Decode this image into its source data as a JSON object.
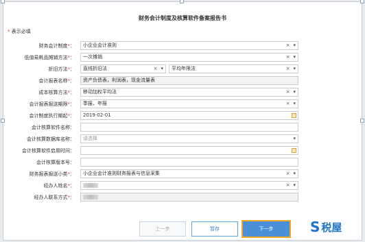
{
  "dialog": {
    "title": "财务会计制度及核算软件备案报告书",
    "required_note": "表示必填"
  },
  "fields": [
    {
      "label": "财务会计制度",
      "required": true,
      "value": "小企业会计准则",
      "kind": "select"
    },
    {
      "label": "低值易耗品摊销方法",
      "required": true,
      "value": "一次摊销",
      "kind": "select"
    },
    {
      "label": "折旧方法",
      "required": true,
      "value": "直线折旧法",
      "value2": "平均年限法",
      "kind": "select2"
    },
    {
      "label": "会计报表名称",
      "required": true,
      "value": "资产负债表，利润表，现金流量表",
      "kind": "readonly"
    },
    {
      "label": "成本核算方法",
      "required": true,
      "value": "移动加权平均法",
      "kind": "select"
    },
    {
      "label": "会计报表报送期限",
      "required": true,
      "value": "季报、年报",
      "kind": "select"
    },
    {
      "label": "会计制度执行期起",
      "required": true,
      "value": "2019-02-01",
      "kind": "date"
    },
    {
      "label": "会计核算软件名称",
      "required": false,
      "value": "",
      "kind": "text"
    },
    {
      "label": "会计核算数据库名称",
      "required": false,
      "value": "请选择",
      "kind": "select-placeholder"
    },
    {
      "label": "会计核算软件启用时间",
      "required": false,
      "value": "",
      "kind": "date"
    },
    {
      "label": "会计核算版本号",
      "required": false,
      "value": "",
      "kind": "text"
    },
    {
      "label": "财务报表报送小类",
      "required": true,
      "value": "小企业会计准则财务报表与信息采集",
      "kind": "select"
    },
    {
      "label": "经办人姓名",
      "required": true,
      "value": "",
      "kind": "select-blur"
    },
    {
      "label": "经办人联系方式",
      "required": true,
      "value": "",
      "kind": "readonly-blur"
    }
  ],
  "buttons": {
    "prev": "上一步",
    "save": "暂存",
    "next": "下一步"
  },
  "logo": {
    "mark": "S",
    "name": "税屋"
  },
  "colors": {
    "required_star": "#e03b3b",
    "primary": "#4a90d9",
    "highlight": "#f5a623",
    "logo": "#1e73c8"
  }
}
